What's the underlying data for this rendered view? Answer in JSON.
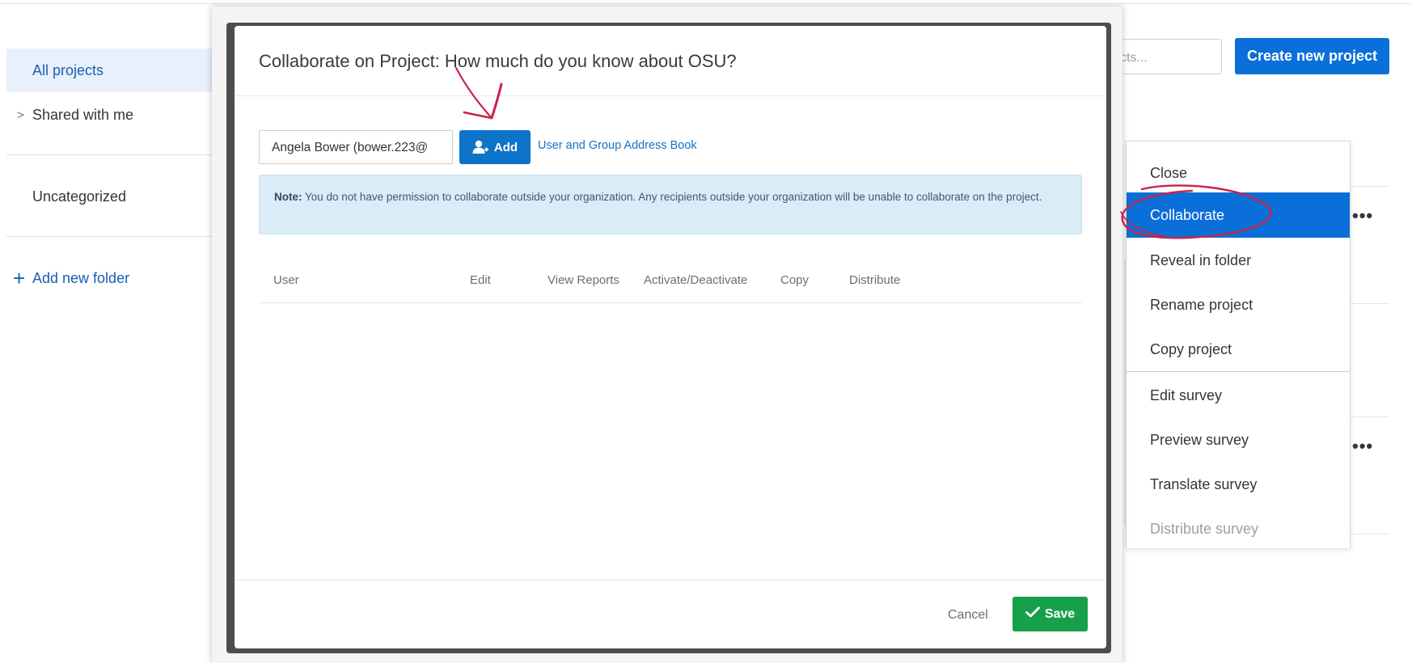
{
  "sidebar": {
    "items": [
      {
        "label": "All projects"
      },
      {
        "label": "Shared with me"
      },
      {
        "label": "Uncategorized"
      }
    ],
    "add_folder_label": "Add new folder"
  },
  "header": {
    "search_placeholder": "cts...",
    "create_label": "Create new project"
  },
  "context_menu": {
    "items": [
      {
        "label": "Close"
      },
      {
        "label": "Collaborate"
      },
      {
        "label": "Reveal in folder"
      },
      {
        "label": "Rename project"
      },
      {
        "label": "Copy project"
      },
      {
        "label": "Edit survey"
      },
      {
        "label": "Preview survey"
      },
      {
        "label": "Translate survey"
      },
      {
        "label": "Distribute survey"
      }
    ]
  },
  "row_more_label": "•••",
  "modal": {
    "title": "Collaborate on Project: How much do you know about OSU?",
    "user_input_value": "Angela Bower (bower.223@",
    "add_label": "Add",
    "address_book_label": "User and Group Address Book",
    "note_bold": "Note:",
    "note_text": " You do not have permission to collaborate outside your organization. Any recipients outside your organization will be unable to collaborate on the project.",
    "columns": [
      "User",
      "Edit",
      "View Reports",
      "Activate/Deactivate",
      "Copy",
      "Distribute"
    ],
    "cancel_label": "Cancel",
    "save_label": "Save"
  },
  "colors": {
    "accent": "#0b6fd9",
    "save_green": "#17a04a",
    "annotation_red": "#c8234a"
  }
}
